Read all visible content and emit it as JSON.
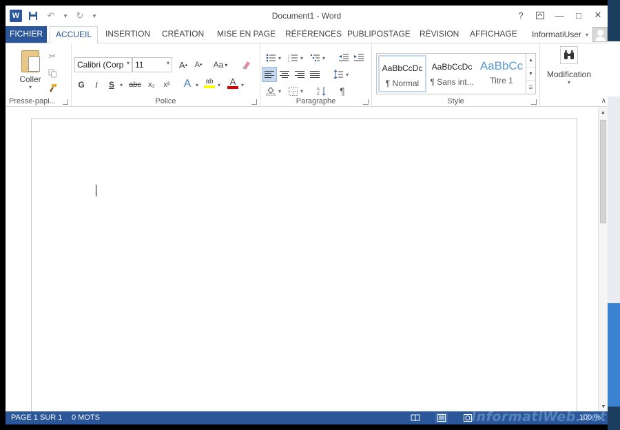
{
  "window": {
    "title": "Document1 - Word"
  },
  "qat": {
    "word_icon": "W",
    "save": "save-icon",
    "undo": "undo-icon",
    "redo": "redo-icon"
  },
  "window_controls": {
    "help": "?",
    "ribbon_display": "ribbon-display-icon",
    "minimize": "—",
    "maximize": "□",
    "close": "✕"
  },
  "tabs": [
    {
      "label": "FICHIER"
    },
    {
      "label": "ACCUEIL"
    },
    {
      "label": "INSERTION"
    },
    {
      "label": "CRÉATION"
    },
    {
      "label": "MISE EN PAGE"
    },
    {
      "label": "RÉFÉRENCES"
    },
    {
      "label": "PUBLIPOSTAGE"
    },
    {
      "label": "RÉVISION"
    },
    {
      "label": "AFFICHAGE"
    }
  ],
  "user": {
    "name": "InformatiUser"
  },
  "ribbon": {
    "clipboard": {
      "paste_label": "Coller",
      "group_label": "Presse-papi..."
    },
    "font": {
      "font_name": "Calibri (Corp",
      "font_size": "11",
      "grow": "A",
      "shrink": "A",
      "case": "Aa",
      "bold": "G",
      "italic": "I",
      "underline": "S",
      "strike": "abc",
      "subscript": "x₂",
      "superscript": "x²",
      "text_effects": "A",
      "highlight": "ab",
      "font_color": "A",
      "group_label": "Police"
    },
    "paragraph": {
      "pilcrow": "¶",
      "group_label": "Paragraphe"
    },
    "styles": {
      "items": [
        {
          "sample": "AaBbCcDc",
          "name": "¶ Normal"
        },
        {
          "sample": "AaBbCcDc",
          "name": "¶ Sans int..."
        },
        {
          "sample": "AaBbCc",
          "name": "Titre 1"
        }
      ],
      "group_label": "Style"
    },
    "editing": {
      "label": "Modification"
    }
  },
  "status": {
    "page": "PAGE 1 SUR 1",
    "words": "0 MOTS",
    "zoom": "100 %"
  },
  "watermark": "InformatiWeb.net",
  "colors": {
    "accent": "#2b579a",
    "highlight_yellow": "#ffff00",
    "font_red": "#e00000"
  }
}
